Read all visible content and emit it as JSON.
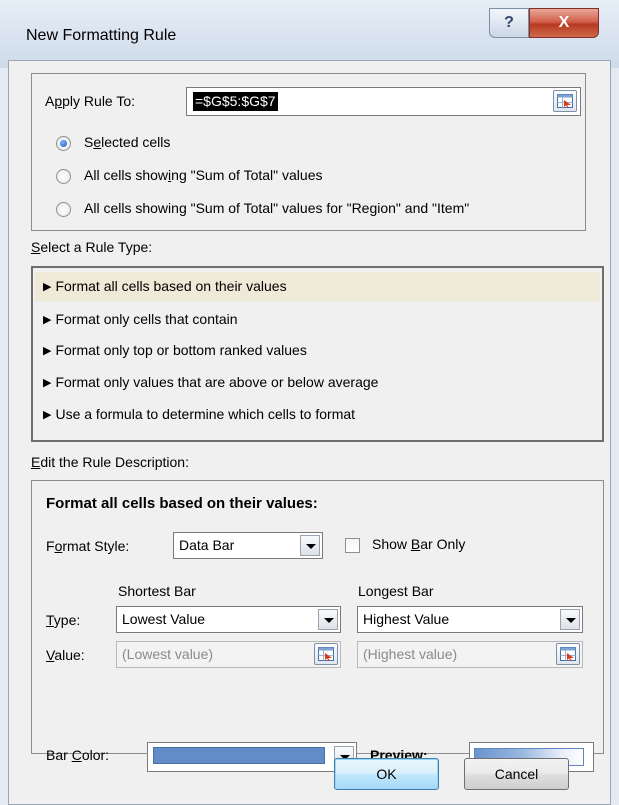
{
  "window": {
    "title": "New Formatting Rule",
    "help_glyph": "?",
    "close_glyph": "X"
  },
  "apply": {
    "label_pre": "A",
    "label_u": "p",
    "label_post": "ply Rule To:",
    "value": "=$G$5:$G$7",
    "options": [
      {
        "pre": "S",
        "u": "e",
        "post": "lected cells",
        "selected": true
      },
      {
        "pre": "All cells show",
        "u": "i",
        "post": "ng \"Sum of Total\" values",
        "selected": false
      },
      {
        "pre": "All cells showin",
        "u": "g",
        "post": " \"Sum of Total\" values for \"Region\" and \"Item\"",
        "selected": false
      }
    ]
  },
  "rule_type": {
    "heading_u": "S",
    "heading_post": "elect a Rule Type:",
    "items": [
      "Format all cells based on their values",
      "Format only cells that contain",
      "Format only top or bottom ranked values",
      "Format only values that are above or below average",
      "Use a formula to determine which cells to format"
    ],
    "selected_index": 0
  },
  "description": {
    "heading_u": "E",
    "heading_post": "dit the Rule Description:",
    "title": "Format all cells based on their values:",
    "format_style_pre": "F",
    "format_style_u": "o",
    "format_style_post": "rmat Style:",
    "format_style_value": "Data Bar",
    "show_bar_only_pre": "Show ",
    "show_bar_only_u": "B",
    "show_bar_only_post": "ar Only",
    "show_bar_only_checked": false,
    "shortest_header": "Shortest Bar",
    "longest_header": "Longest Bar",
    "type_u": "T",
    "type_post": "ype:",
    "value_u": "V",
    "value_post": "alue:",
    "shortest_type": "Lowest Value",
    "longest_type": "Highest Value",
    "shortest_value_placeholder": "(Lowest value)",
    "longest_value_placeholder": "(Highest value)",
    "bar_color_pre": "Bar ",
    "bar_color_u": "C",
    "bar_color_post": "olor:",
    "bar_color_hex": "#628cc8",
    "preview_label": "Preview:"
  },
  "buttons": {
    "ok": "OK",
    "cancel": "Cancel"
  }
}
